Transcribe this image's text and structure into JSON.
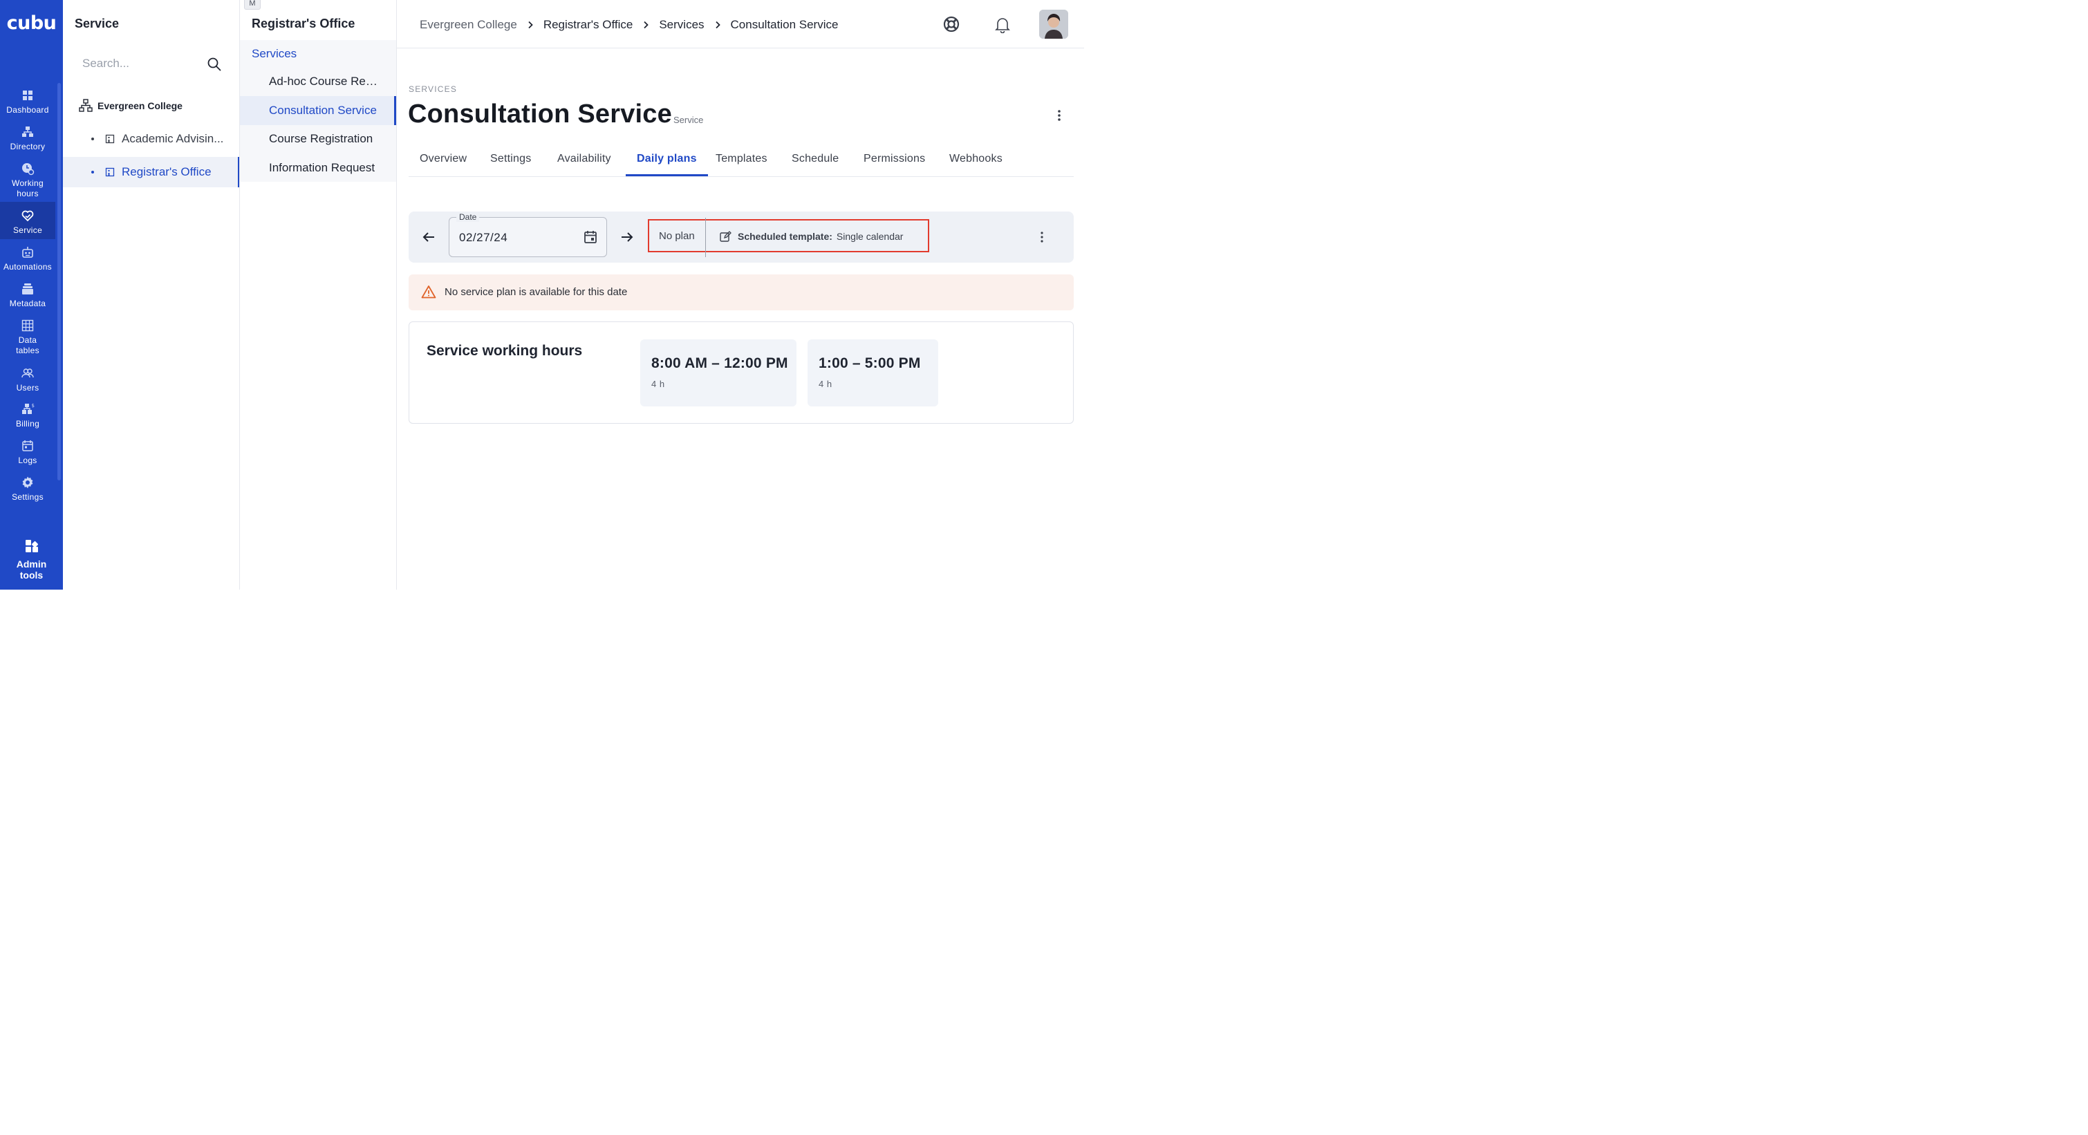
{
  "rail": {
    "logo": "cubu",
    "items": [
      {
        "label": "Dashboard",
        "icon": "dashboard-icon"
      },
      {
        "label": "Directory",
        "icon": "directory-icon"
      },
      {
        "label": "Working hours",
        "icon": "working-hours-icon"
      },
      {
        "label": "Service",
        "icon": "service-icon"
      },
      {
        "label": "Automations",
        "icon": "automations-icon"
      },
      {
        "label": "Metadata",
        "icon": "metadata-icon"
      },
      {
        "label": "Data tables",
        "icon": "data-tables-icon"
      },
      {
        "label": "Users",
        "icon": "users-icon"
      },
      {
        "label": "Billing",
        "icon": "billing-icon"
      },
      {
        "label": "Logs",
        "icon": "logs-icon"
      },
      {
        "label": "Settings",
        "icon": "gear-icon"
      }
    ],
    "active_item": "Service",
    "admin_tools": "Admin tools"
  },
  "tree_panel": {
    "title": "Service",
    "search_placeholder": "Search...",
    "root": "Evergreen College",
    "items": [
      {
        "label": "Academic Advisin..."
      },
      {
        "label": "Registrar's Office"
      }
    ],
    "active_item": "Registrar's Office"
  },
  "services_panel": {
    "badge": "M",
    "title": "Registrar's Office",
    "subtitle": "Services",
    "items": [
      {
        "label": "Ad-hoc Course Regi..."
      },
      {
        "label": "Consultation Service"
      },
      {
        "label": "Course Registration"
      },
      {
        "label": "Information Request"
      }
    ],
    "active_item": "Consultation Service"
  },
  "topbar": {
    "breadcrumbs": [
      "Evergreen College",
      "Registrar's Office",
      "Services",
      "Consultation Service"
    ]
  },
  "page": {
    "eyebrow": "SERVICES",
    "title": "Consultation Service",
    "type": "Service",
    "tabs": [
      "Overview",
      "Settings",
      "Availability",
      "Daily plans",
      "Templates",
      "Schedule",
      "Permissions",
      "Webhooks"
    ],
    "active_tab": "Daily plans"
  },
  "date_bar": {
    "date_label": "Date",
    "date_value": "02/27/24",
    "plan_status": "No plan",
    "scheduled_template_label": "Scheduled template:",
    "scheduled_template_value": "Single calendar"
  },
  "alert": {
    "message": "No service plan is available for this date"
  },
  "working_hours": {
    "title": "Service working hours",
    "slots": [
      {
        "range": "8:00 AM – 12:00 PM",
        "duration": "4 h"
      },
      {
        "range": "1:00 – 5:00 PM",
        "duration": "4 h"
      }
    ]
  },
  "colors": {
    "rail": "#2049c6",
    "accent": "#2049c6",
    "highlight_box": "#e23b2e",
    "alert_bg": "#fbf0ec",
    "warning": "#e0632a"
  }
}
